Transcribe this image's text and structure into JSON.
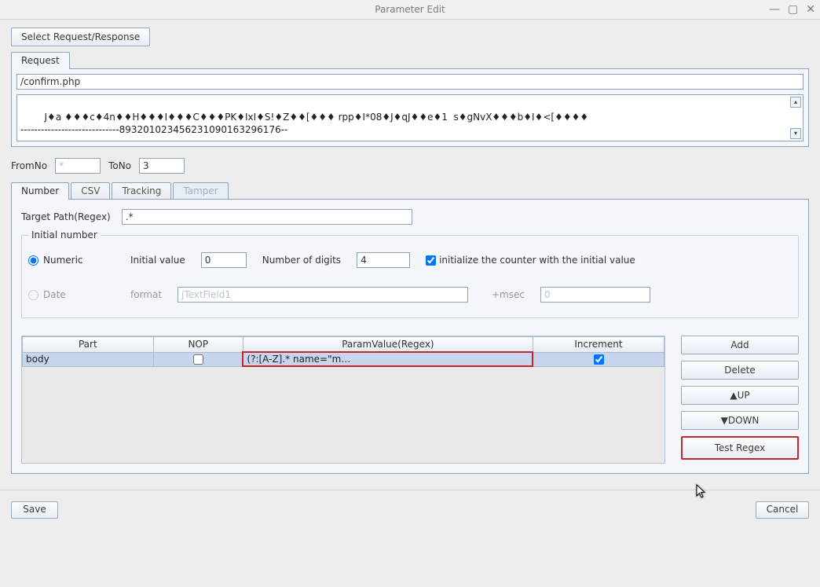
{
  "window": {
    "title": "Parameter Edit"
  },
  "buttons": {
    "select_request": "Select Request/Response",
    "save": "Save",
    "cancel": "Cancel",
    "add": "Add",
    "delete": "Delete",
    "up": "▲UP",
    "down": "▼DOWN",
    "test_regex": "Test Regex"
  },
  "tabs": {
    "request": "Request",
    "number": "Number",
    "csv": "CSV",
    "tracking": "Tracking",
    "tamper": "Tamper"
  },
  "request": {
    "url": "/confirm.php",
    "body_display": "J♦a ♦♦♦c♦4n♦♦H♦♦♦I♦♦♦C♦♦♦PK♦IxI♦S!♦Z♦♦[♦♦♦ rpp♦I*08♦J♦qJ♦♦e♦1  s♦gNvX♦♦♦b♦I♦<[♦♦♦♦\n-----------------------------893201023456231090163296176--"
  },
  "fromto": {
    "from_label": "FromNo",
    "from_placeholder": "*",
    "to_label": "ToNo",
    "to_value": "3"
  },
  "number": {
    "target_path_label": "Target Path(Regex)",
    "target_path_value": ".*",
    "fieldset_legend": "Initial number",
    "numeric_label": "Numeric",
    "date_label": "Date",
    "initial_value_label": "Initial value",
    "initial_value": "0",
    "digits_label": "Number of digits",
    "digits_value": "4",
    "init_counter_label": "initialize the counter with the initial value",
    "format_label": "format",
    "format_placeholder": "jTextField1",
    "msec_label": "+msec",
    "msec_value": "0"
  },
  "table": {
    "headers": {
      "part": "Part",
      "nop": "NOP",
      "paramvalue": "ParamValue(Regex)",
      "increment": "Increment"
    },
    "rows": [
      {
        "part": "body",
        "nop": false,
        "paramvalue": "(?:[A-Z].* name=\"m…",
        "increment": true
      }
    ]
  }
}
